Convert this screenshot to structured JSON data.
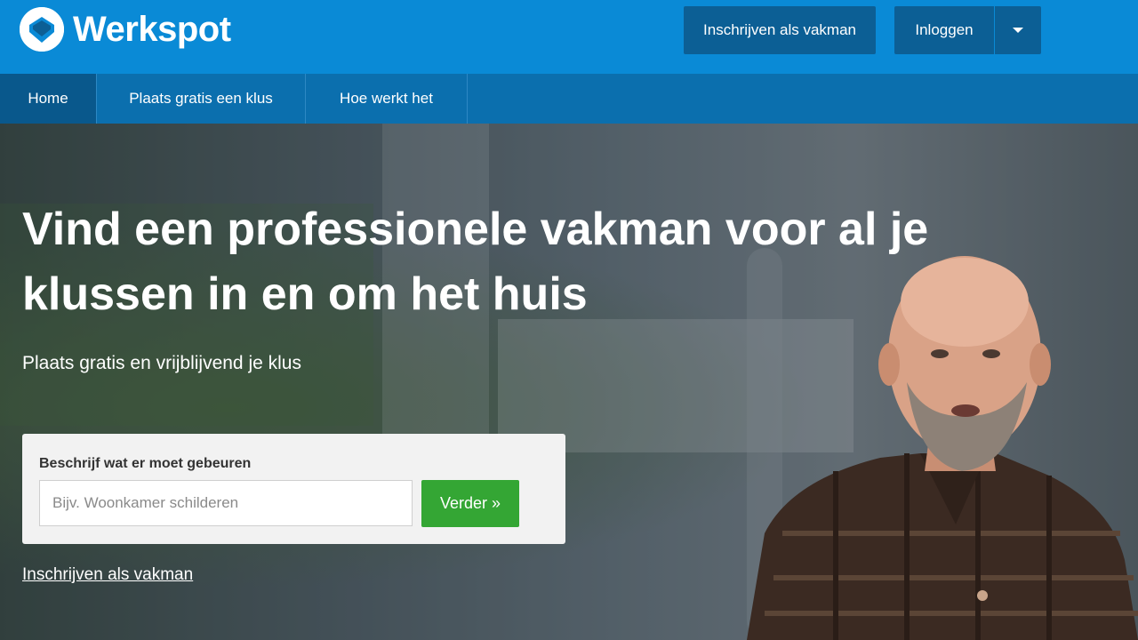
{
  "header": {
    "logo_text": "Werkspot",
    "signup_button": "Inschrijven als vakman",
    "login_button": "Inloggen"
  },
  "nav": {
    "items": [
      {
        "label": "Home",
        "active": true
      },
      {
        "label": "Plaats gratis een klus",
        "active": false
      },
      {
        "label": "Hoe werkt het",
        "active": false
      }
    ]
  },
  "hero": {
    "headline_line1": "Vind een professionele vakman voor al je",
    "headline_line2": "klussen in en om het huis",
    "subheading": "Plaats gratis en vrijblijvend je klus"
  },
  "search_card": {
    "label": "Beschrijf wat er moet gebeuren",
    "input_placeholder": "Bijv. Woonkamer schilderen",
    "input_value": "",
    "submit_button": "Verder »"
  },
  "footer_link": "Inschrijven als vakman",
  "colors": {
    "header_blue": "#0a8ad6",
    "nav_blue": "#0b6fae",
    "button_dark_blue": "#0c5f95",
    "cta_green": "#34a634"
  },
  "icons": {
    "logo": "werkspot-logo-icon",
    "dropdown": "chevron-down-icon"
  }
}
